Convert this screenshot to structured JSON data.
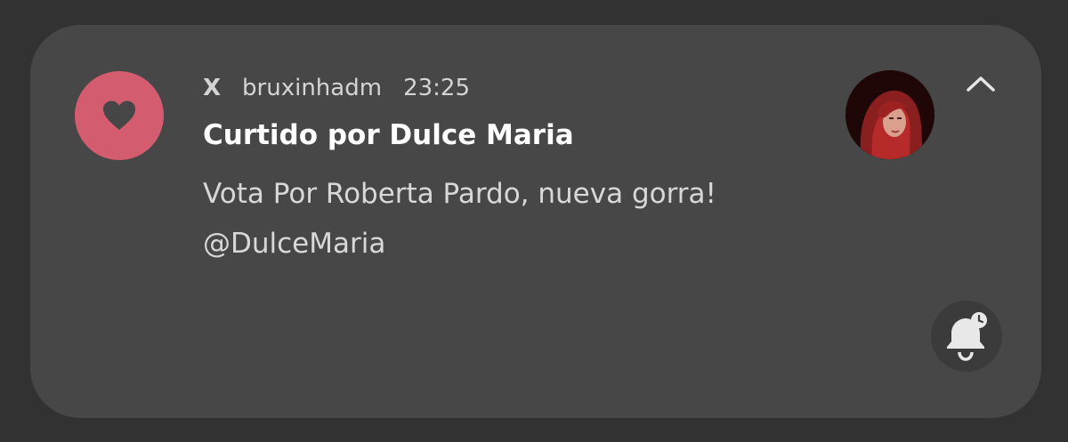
{
  "notification": {
    "app_name": "X",
    "account": "bruxinhadm",
    "time": "23:25",
    "title": "Curtido por Dulce Maria",
    "body_line1": "Vota Por Roberta Pardo, nueva gorra!",
    "body_line2": "@DulceMaria",
    "app_icon": "heart-icon",
    "accent_color": "#d35c6f",
    "actions": {
      "collapse_icon": "chevron-up-icon",
      "snooze_icon": "bell-snooze-icon"
    }
  }
}
